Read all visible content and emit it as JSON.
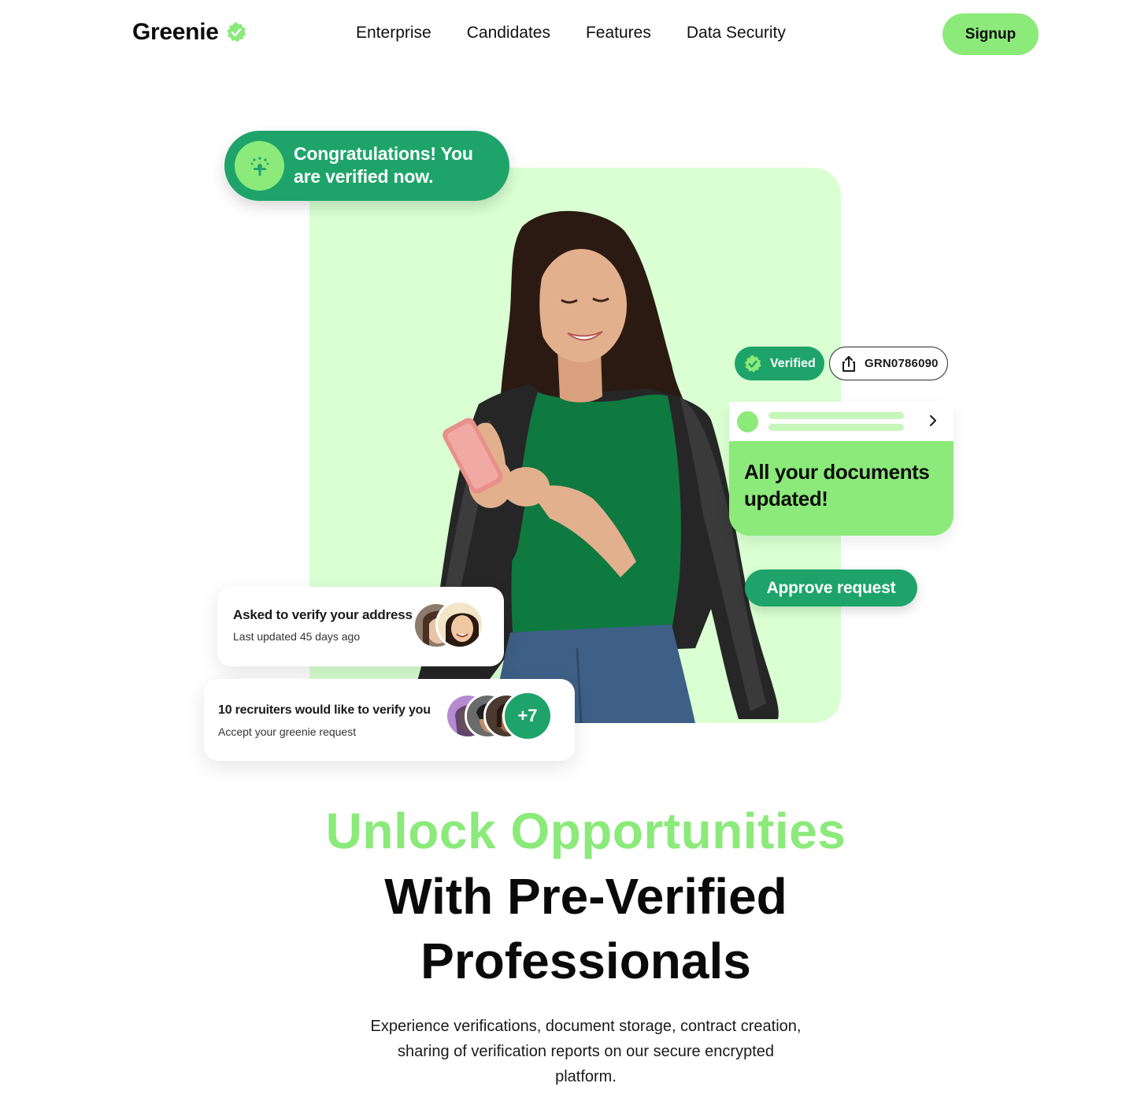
{
  "nav": {
    "logo_text": "Greenie",
    "links": [
      "Enterprise",
      "Candidates",
      "Features",
      "Data Security"
    ],
    "signup_label": "Signup"
  },
  "hero": {
    "congrats_text": "Congratulations! You are verified now.",
    "verified_label": "Verified",
    "grn_id": "GRN0786090",
    "documents_text": "All your documents updated!",
    "approve_label": "Approve request",
    "address_card": {
      "title": "Asked to verify your address",
      "subtitle": "Last updated 45 days ago"
    },
    "recruiter_card": {
      "title": "10 recruiters would like to verify you",
      "subtitle": "Accept your greenie request",
      "extra_count": "+7"
    }
  },
  "headline": {
    "line1": "Unlock Opportunities",
    "line2": "With Pre-Verified",
    "line3": "Professionals"
  },
  "description": "Experience verifications, document storage, contract creation, sharing of verification reports on our secure encrypted platform.",
  "colors": {
    "brand_green": "#8bea7a",
    "dark_green": "#1ea46a",
    "light_green_bg": "#d9ffd2"
  }
}
